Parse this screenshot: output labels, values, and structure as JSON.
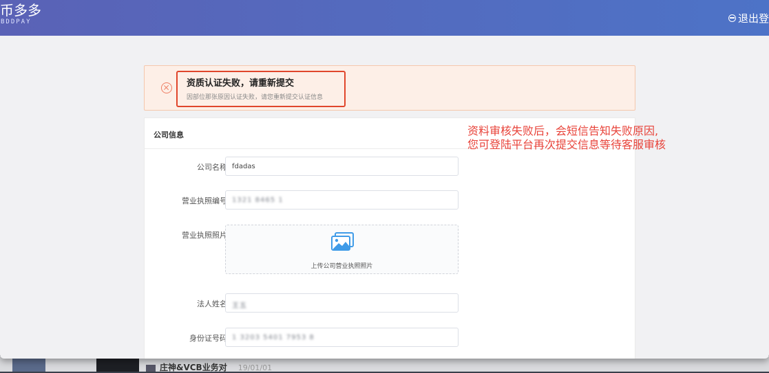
{
  "app": {
    "logo_cn": "币多多",
    "logo_en": "BDDPAY",
    "logout_label": "退出登"
  },
  "alert": {
    "title": "资质认证失败，请重新提交",
    "message": "因部位那张原因认证失败，请您重新提交认证信息"
  },
  "card": {
    "title": "公司信息",
    "fields": [
      {
        "label": "公司名称",
        "value": "fdadas",
        "blurred": false
      },
      {
        "label": "营业执照编号",
        "value": "1321 8465 1",
        "blurred": true
      },
      {
        "label": "营业执照照片",
        "upload_text": "上传公司营业执照照片"
      },
      {
        "label": "法人姓名",
        "value": "王五",
        "blurred": true
      },
      {
        "label": "身份证号码",
        "value": "1 3203 5401 7953 8",
        "blurred": true
      }
    ]
  },
  "annotation": {
    "line1": "资料审核失败后，会短信告知失败原因,",
    "line2": "您可登陆平台再次提交信息等待客服审核"
  },
  "background": {
    "task_title": "庄神&VCB业务对",
    "task_date": "19/01/01"
  },
  "colors": {
    "header_gradient_start": "#5a62b6",
    "header_gradient_end": "#4d73c7",
    "alert_bg": "#fdefe7",
    "highlight_border": "#e0452b",
    "annotation_text": "#e8433a",
    "upload_icon": "#3f9be8"
  },
  "icons": {
    "logout": "logout-icon",
    "alert": "error-circle-icon",
    "upload": "image-upload-icon"
  }
}
